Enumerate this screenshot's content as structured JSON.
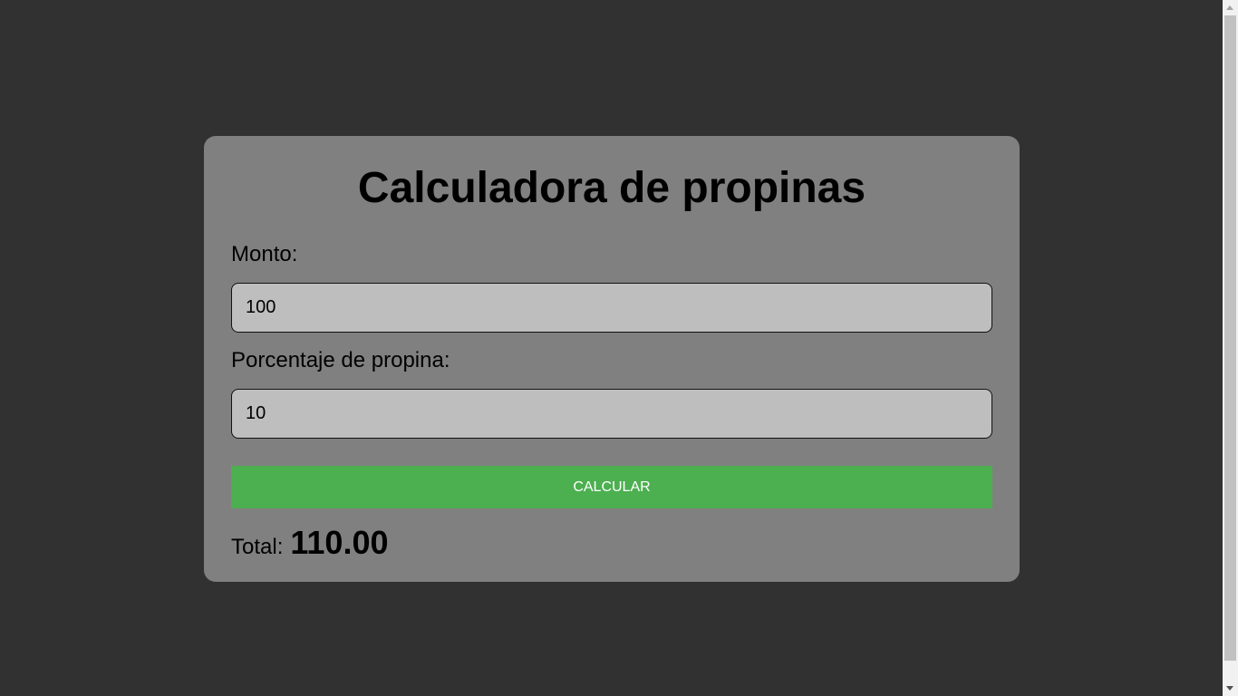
{
  "app": {
    "title": "Calculadora de propinas"
  },
  "form": {
    "amount_label": "Monto:",
    "amount_value": "100",
    "tip_label": "Porcentaje de propina:",
    "tip_value": "10",
    "calculate_label": "CALCULAR"
  },
  "result": {
    "total_label": "Total:",
    "total_value": "110.00"
  },
  "colors": {
    "page_background": "#313131",
    "card_background": "#808080",
    "input_background": "#bebebe",
    "button_background": "#4caf50",
    "button_text": "#ffffff"
  }
}
